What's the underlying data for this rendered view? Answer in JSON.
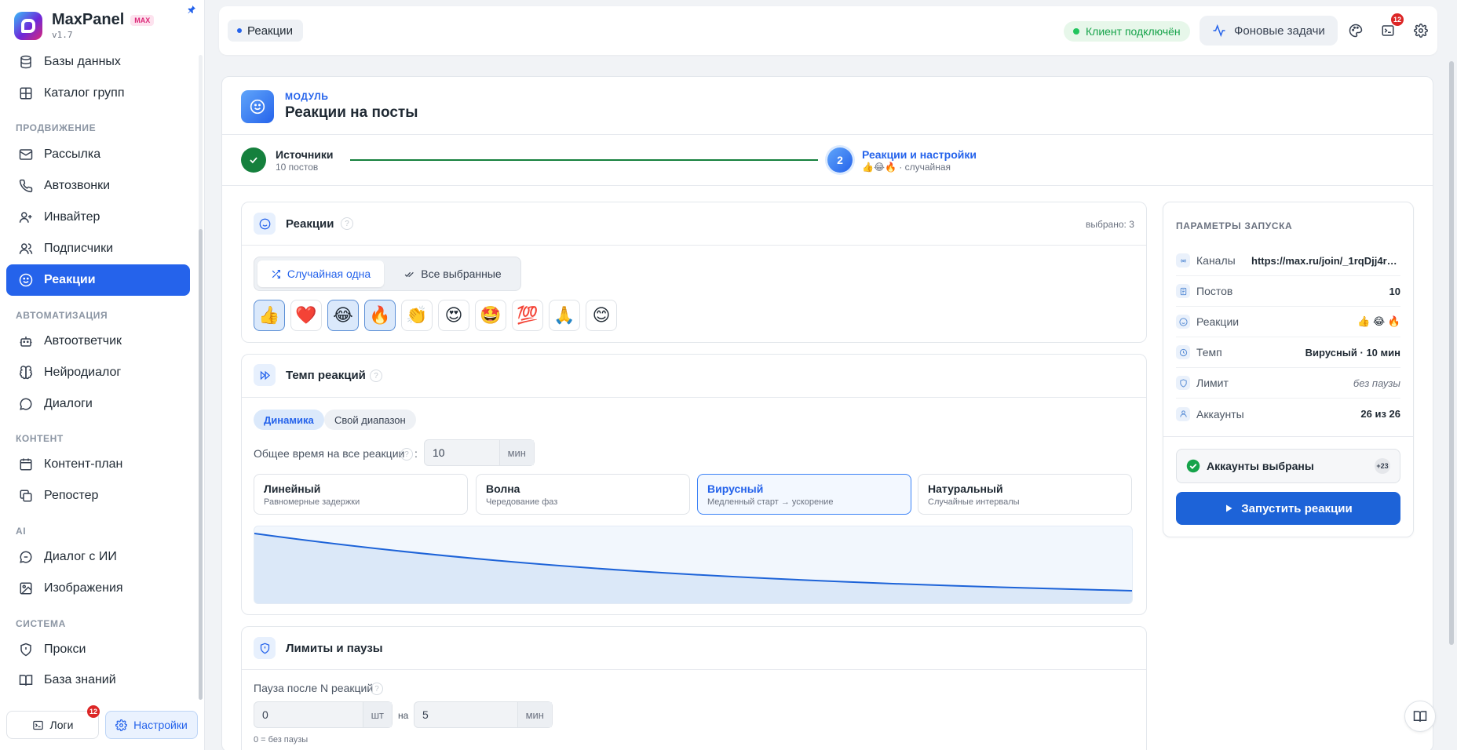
{
  "app": {
    "name": "MaxPanel",
    "badge": "MAX",
    "version": "v1.7"
  },
  "sidebar": {
    "items": [
      {
        "label": "Базы данных",
        "icon": "database-icon"
      },
      {
        "label": "Каталог групп",
        "icon": "grid-icon"
      },
      {
        "label": "Рассылка",
        "icon": "mail-icon"
      },
      {
        "label": "Автозвонки",
        "icon": "phone-icon"
      },
      {
        "label": "Инвайтер",
        "icon": "user-plus-icon"
      },
      {
        "label": "Подписчики",
        "icon": "users-icon"
      },
      {
        "label": "Реакции",
        "icon": "smile-icon",
        "active": true
      },
      {
        "label": "Автоответчик",
        "icon": "bot-icon"
      },
      {
        "label": "Нейродиалог",
        "icon": "brain-icon"
      },
      {
        "label": "Диалоги",
        "icon": "chat-icon"
      },
      {
        "label": "Контент-план",
        "icon": "calendar-icon"
      },
      {
        "label": "Репостер",
        "icon": "copy-icon"
      },
      {
        "label": "Диалог с ИИ",
        "icon": "ai-chat-icon"
      },
      {
        "label": "Изображения",
        "icon": "image-icon"
      },
      {
        "label": "Прокси",
        "icon": "shield-icon"
      },
      {
        "label": "База знаний",
        "icon": "book-icon"
      }
    ],
    "sections": {
      "promo": "ПРОДВИЖЕНИЕ",
      "auto": "АВТОМАТИЗАЦИЯ",
      "content": "КОНТЕНТ",
      "ai": "AI",
      "system": "СИСТЕМА"
    },
    "logs_label": "Логи",
    "logs_badge": "12",
    "settings_label": "Настройки"
  },
  "header": {
    "breadcrumb": "Реакции",
    "status": "Клиент подключён",
    "bg_tasks": "Фоновые задачи",
    "terminal_badge": "12"
  },
  "module": {
    "kicker": "МОДУЛЬ",
    "title": "Реакции на посты"
  },
  "stepper": {
    "step1_title": "Источники",
    "step1_sub": "10 постов",
    "step2_num": "2",
    "step2_title": "Реакции и настройки",
    "step2_sub": "👍😂🔥 · случайная"
  },
  "reactions": {
    "title": "Реакции",
    "selected": "выбрано: 3",
    "mode_random": "Случайная одна",
    "mode_all": "Все выбранные",
    "emojis": [
      {
        "e": "👍",
        "sel": true
      },
      {
        "e": "❤️",
        "sel": false
      },
      {
        "e": "😂",
        "sel": true
      },
      {
        "e": "🔥",
        "sel": true
      },
      {
        "e": "👏",
        "sel": false
      },
      {
        "e": "😍",
        "sel": false
      },
      {
        "e": "🤩",
        "sel": false
      },
      {
        "e": "💯",
        "sel": false
      },
      {
        "e": "🙏",
        "sel": false
      },
      {
        "e": "😊",
        "sel": false
      }
    ]
  },
  "tempo": {
    "title": "Темп реакций",
    "tab_dynamic": "Динамика",
    "tab_range": "Свой диапазон",
    "total_label": "Общее время на все реакции",
    "total_value": "10",
    "total_unit": "мин",
    "modes": [
      {
        "title": "Линейный",
        "sub": "Равномерные задержки"
      },
      {
        "title": "Волна",
        "sub": "Чередование фаз"
      },
      {
        "title": "Вирусный",
        "sub": "Медленный старт → ускорение",
        "on": true
      },
      {
        "title": "Натуральный",
        "sub": "Случайные интервалы"
      }
    ]
  },
  "limits": {
    "title": "Лимиты и паузы",
    "pause_label": "Пауза после N реакций",
    "count_value": "0",
    "count_unit": "шт",
    "on_label": "на",
    "minutes_value": "5",
    "minutes_unit": "мин",
    "hint": "0 = без паузы"
  },
  "launch_params": {
    "title": "ПАРАМЕТРЫ ЗАПУСКА",
    "rows": [
      {
        "k": "Каналы",
        "v": "https://max.ru/join/_1rqDjj4r8...",
        "icon": "broadcast-icon"
      },
      {
        "k": "Постов",
        "v": "10",
        "icon": "doc-icon"
      },
      {
        "k": "Реакции",
        "v": "👍 😂 🔥",
        "icon": "smile-icon"
      },
      {
        "k": "Темп",
        "v": "Вирусный · 10 мин",
        "icon": "clock-icon"
      },
      {
        "k": "Лимит",
        "v": "без паузы",
        "icon": "shield-icon"
      },
      {
        "k": "Аккаунты",
        "v": "26 из 26",
        "icon": "user-icon"
      }
    ],
    "accounts_label": "Аккаунты выбраны",
    "accounts_badge": "+23",
    "launch_label": "Запустить реакции"
  },
  "colors": {
    "accent": "#2563eb",
    "success": "#15803d",
    "danger": "#dc2626"
  }
}
